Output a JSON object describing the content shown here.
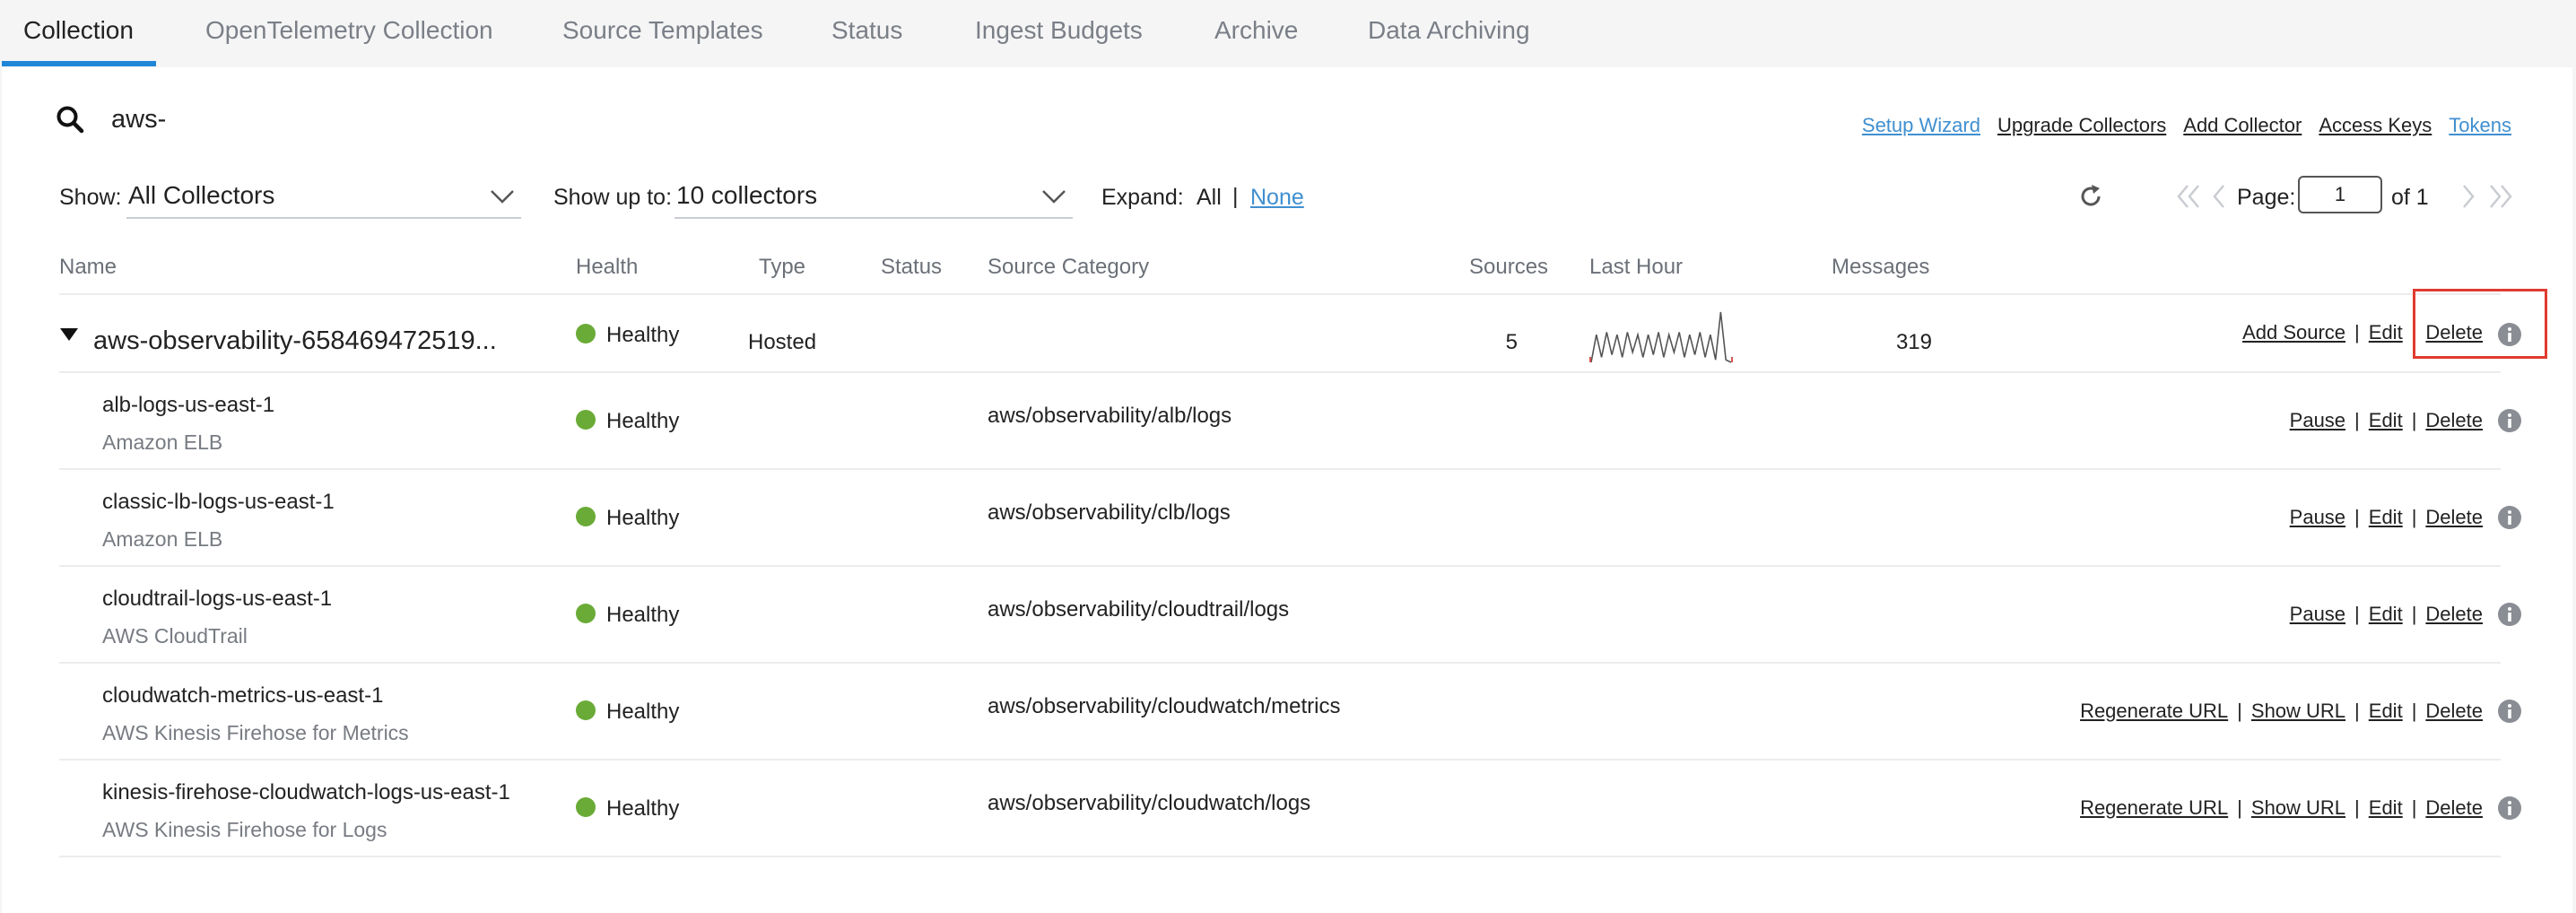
{
  "tabs": [
    {
      "label": "Collection",
      "active": true
    },
    {
      "label": "OpenTelemetry Collection"
    },
    {
      "label": "Source Templates"
    },
    {
      "label": "Status"
    },
    {
      "label": "Ingest Budgets"
    },
    {
      "label": "Archive"
    },
    {
      "label": "Data Archiving"
    }
  ],
  "search": {
    "value": "aws-",
    "icon": "search-icon"
  },
  "top_links": [
    "Setup Wizard",
    "Upgrade Collectors",
    "Add Collector",
    "Access Keys",
    "Tokens"
  ],
  "filters": {
    "show_label": "Show:",
    "show_value": "All Collectors",
    "show_up_to_label": "Show up to:",
    "show_up_to_value": "10 collectors",
    "expand_label": "Expand:",
    "expand_all": "All",
    "expand_sep": "|",
    "expand_none": "None"
  },
  "pagination": {
    "page_label": "Page:",
    "page_value": "1",
    "of_label": "of 1"
  },
  "columns": {
    "name": "Name",
    "health": "Health",
    "type": "Type",
    "status": "Status",
    "category": "Source Category",
    "sources": "Sources",
    "last_hour": "Last Hour",
    "messages": "Messages"
  },
  "collector": {
    "name": "aws-observability-658469472519...",
    "health": "Healthy",
    "type": "Hosted",
    "sources": "5",
    "messages": "319",
    "actions": [
      "Add Source",
      "Edit",
      "Delete"
    ],
    "last_hour_sparkline": [
      0,
      0.55,
      0.1,
      0.6,
      0.15,
      0.55,
      0.1,
      0.6,
      0.2,
      0.55,
      0.1,
      0.55,
      0.15,
      0.6,
      0.1,
      0.55,
      0.2,
      0.6,
      0.1,
      0.55,
      0.15,
      0.6,
      0.1,
      0.55,
      0.05,
      1.0,
      0.05,
      0.0
    ]
  },
  "source_rows": [
    {
      "name": "alb-logs-us-east-1",
      "sub": "Amazon ELB",
      "health": "Healthy",
      "category": "aws/observability/alb/logs",
      "actions": [
        "Pause",
        "Edit",
        "Delete"
      ]
    },
    {
      "name": "classic-lb-logs-us-east-1",
      "sub": "Amazon ELB",
      "health": "Healthy",
      "category": "aws/observability/clb/logs",
      "actions": [
        "Pause",
        "Edit",
        "Delete"
      ]
    },
    {
      "name": "cloudtrail-logs-us-east-1",
      "sub": "AWS CloudTrail",
      "health": "Healthy",
      "category": "aws/observability/cloudtrail/logs",
      "actions": [
        "Pause",
        "Edit",
        "Delete"
      ]
    },
    {
      "name": "cloudwatch-metrics-us-east-1",
      "sub": "AWS Kinesis Firehose for Metrics",
      "health": "Healthy",
      "category": "aws/observability/cloudwatch/metrics",
      "actions": [
        "Regenerate URL",
        "Show URL",
        "Edit",
        "Delete"
      ]
    },
    {
      "name": "kinesis-firehose-cloudwatch-logs-us-east-1",
      "sub": "AWS Kinesis Firehose for Logs",
      "health": "Healthy",
      "category": "aws/observability/cloudwatch/logs",
      "actions": [
        "Regenerate URL",
        "Show URL",
        "Edit",
        "Delete"
      ]
    }
  ],
  "colors": {
    "accent": "#1f86d8",
    "link_blue": "#3f8fd0",
    "healthy": "#6aab37",
    "highlight": "#e03b2f"
  }
}
